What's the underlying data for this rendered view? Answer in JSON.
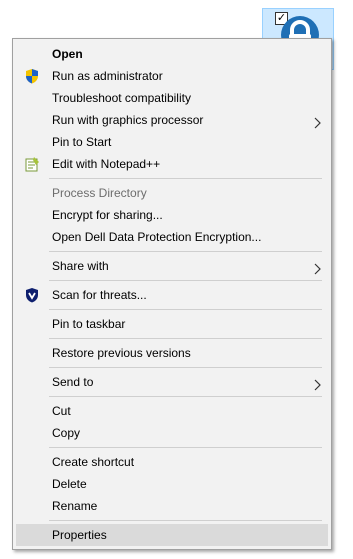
{
  "desktop": {
    "file_icon": {
      "icon": "lock-icon",
      "checked": true,
      "checkmark": "✓"
    }
  },
  "menu": {
    "groups": [
      [
        {
          "label": "Open",
          "bold": true,
          "icon": null
        },
        {
          "label": "Run as administrator",
          "icon": "uac-shield-icon"
        },
        {
          "label": "Troubleshoot compatibility",
          "icon": null
        },
        {
          "label": "Run with graphics processor",
          "icon": null,
          "submenu": true
        },
        {
          "label": "Pin to Start",
          "icon": null
        },
        {
          "label": "Edit with Notepad++",
          "icon": "notepadpp-icon"
        }
      ],
      [
        {
          "label": "Process Directory",
          "disabled": true
        },
        {
          "label": "Encrypt for sharing..."
        },
        {
          "label": "Open Dell Data Protection Encryption..."
        }
      ],
      [
        {
          "label": "Share with",
          "submenu": true
        }
      ],
      [
        {
          "label": "Scan for threats...",
          "icon": "defender-shield-icon"
        }
      ],
      [
        {
          "label": "Pin to taskbar"
        }
      ],
      [
        {
          "label": "Restore previous versions"
        }
      ],
      [
        {
          "label": "Send to",
          "submenu": true
        }
      ],
      [
        {
          "label": "Cut"
        },
        {
          "label": "Copy"
        }
      ],
      [
        {
          "label": "Create shortcut"
        },
        {
          "label": "Delete"
        },
        {
          "label": "Rename"
        }
      ],
      [
        {
          "label": "Properties",
          "highlighted": true
        }
      ]
    ]
  },
  "colors": {
    "menu_background": "#f2f2f2",
    "highlight": "#dadada",
    "disabled_text": "#6d6d6d",
    "selection_background": "#cce8ff"
  }
}
